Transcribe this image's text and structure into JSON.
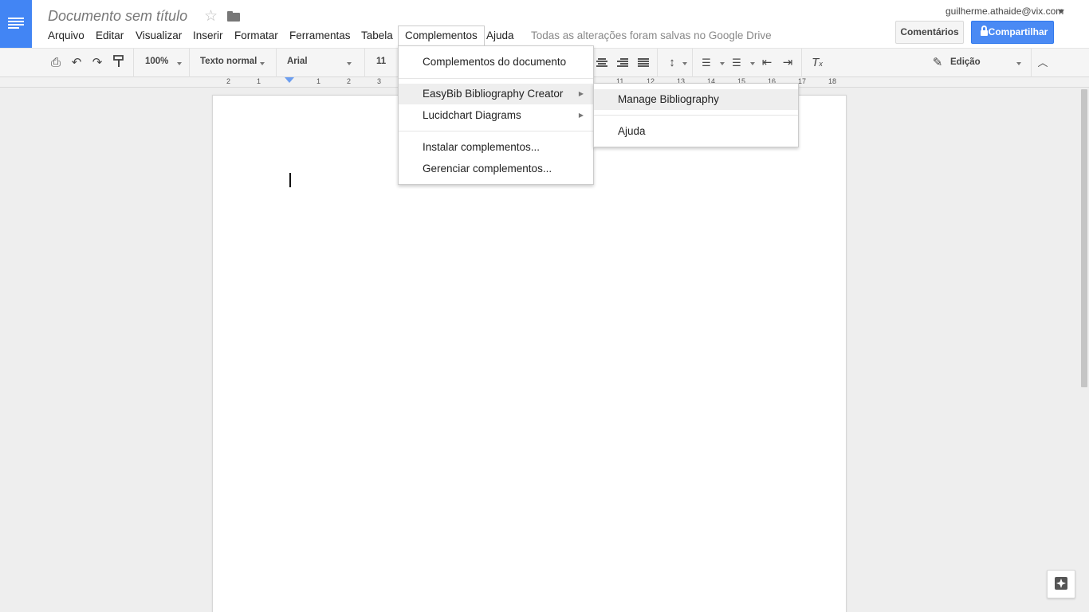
{
  "header": {
    "title": "Documento sem título",
    "user_email": "guilherme.athaide@vix.com",
    "comments_label": "Comentários",
    "share_label": "Compartilhar",
    "save_status": "Todas as alterações foram salvas no Google Drive"
  },
  "menubar": {
    "items": [
      "Arquivo",
      "Editar",
      "Visualizar",
      "Inserir",
      "Formatar",
      "Ferramentas",
      "Tabela",
      "Complementos",
      "Ajuda"
    ]
  },
  "toolbar": {
    "zoom": "100%",
    "style": "Texto normal",
    "font": "Arial",
    "font_size": "11",
    "mode": "Edição"
  },
  "ruler": {
    "labels": [
      "2",
      "1",
      "1",
      "2",
      "3",
      "11",
      "12",
      "13",
      "14",
      "15",
      "16",
      "17",
      "18"
    ]
  },
  "addons_menu": {
    "items": [
      "Complementos do documento",
      "EasyBib Bibliography Creator",
      "Lucidchart Diagrams",
      "Instalar complementos...",
      "Gerenciar complementos..."
    ]
  },
  "easybib_submenu": {
    "items": [
      "Manage Bibliography",
      "Ajuda"
    ]
  },
  "colors": {
    "brand": "#4285f4",
    "share_button": "#4a8af4"
  }
}
